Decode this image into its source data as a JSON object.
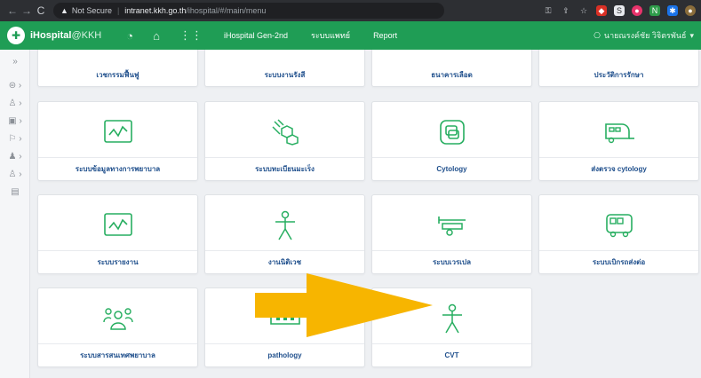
{
  "browser": {
    "back_icon": "arrow-left-icon",
    "forward_icon": "arrow-right-icon",
    "reload_icon": "reload-icon",
    "security_label": "Not Secure",
    "host": "intranet.kkh.go.th",
    "path": "/ihospital/#/main/menu"
  },
  "header": {
    "app_name": "iHospital",
    "app_suffix": "@KKH",
    "link_gen2": "iHospital Gen-2nd",
    "link_doctor": "ระบบแพทย์",
    "link_report": "Report",
    "user_name": "นายณรงค์ชัย วิจิตรพันธ์"
  },
  "menu": {
    "row0": [
      "เวชกรรมฟื้นฟู",
      "ระบบงานรังสี",
      "ธนาคารเลือด",
      "ประวัติการรักษา"
    ],
    "row1": [
      "ระบบข้อมูลทางการพยาบาล",
      "ระบบทะเบียนมะเร็ง",
      "Cytology",
      "ส่งตรวจ cytology"
    ],
    "row2": [
      "ระบบรายงาน",
      "งานนิติเวช",
      "ระบบเวรเปล",
      "ระบบเบิกรถส่งต่อ"
    ],
    "row3": [
      "ระบบสารสนเทศพยาบาล",
      "pathology",
      "CVT"
    ]
  },
  "colors": {
    "header_green": "#1f9d55",
    "icon_green": "#27ae60",
    "label_blue": "#1f4f8c",
    "arrow_yellow": "#f7b500"
  }
}
